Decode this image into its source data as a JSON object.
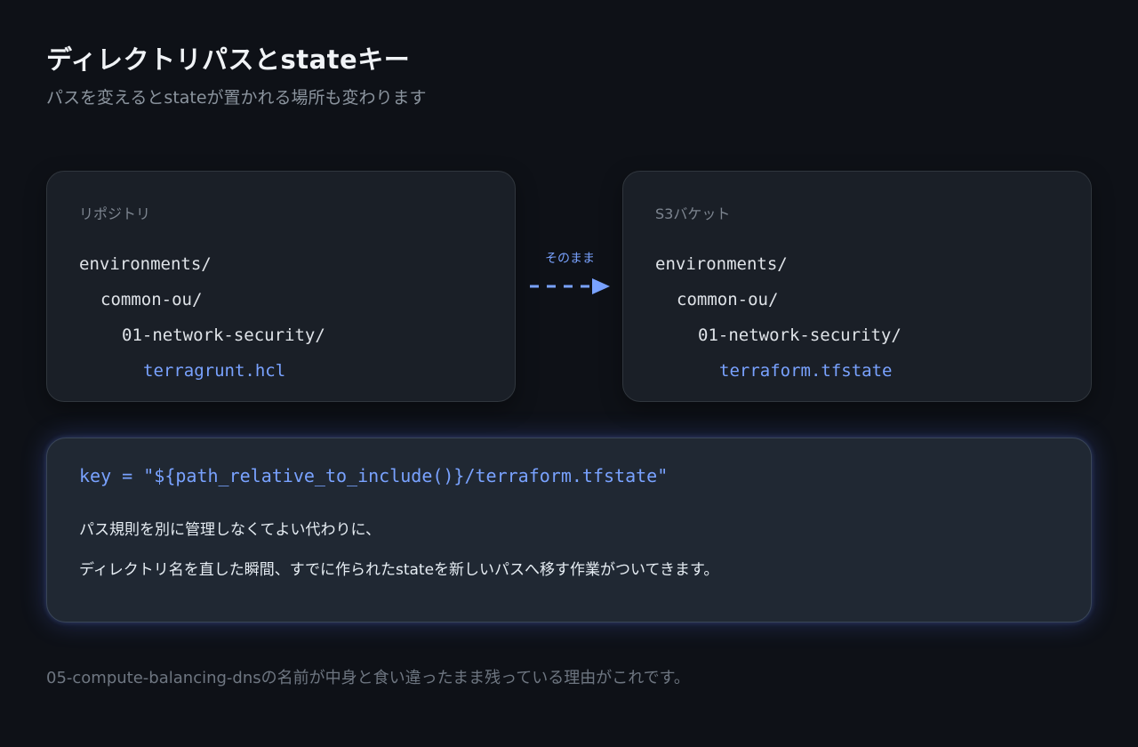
{
  "header": {
    "title": "ディレクトリパスとstateキー",
    "subtitle": "パスを変えるとstateが置かれる場所も変わります"
  },
  "repo_card": {
    "label": "リポジトリ",
    "lines": [
      "environments/",
      "common-ou/",
      "01-network-security/",
      "terragrunt.hcl"
    ]
  },
  "arrow": {
    "label": "そのまま"
  },
  "s3_card": {
    "label": "S3バケット",
    "lines": [
      "environments/",
      "common-ou/",
      "01-network-security/",
      "terraform.tfstate"
    ]
  },
  "key_box": {
    "code": "key = \"${path_relative_to_include()}/terraform.tfstate\"",
    "line1": "パス規則を別に管理しなくてよい代わりに、",
    "line2": "ディレクトリ名を直した瞬間、すでに作られたstateを新しいパスへ移す作業がついてきます。"
  },
  "footer": {
    "text": "05-compute-balancing-dnsの名前が中身と食い違ったまま残っている理由がこれです。"
  },
  "colors": {
    "accent": "#79a2ff",
    "background": "#0e1117"
  }
}
